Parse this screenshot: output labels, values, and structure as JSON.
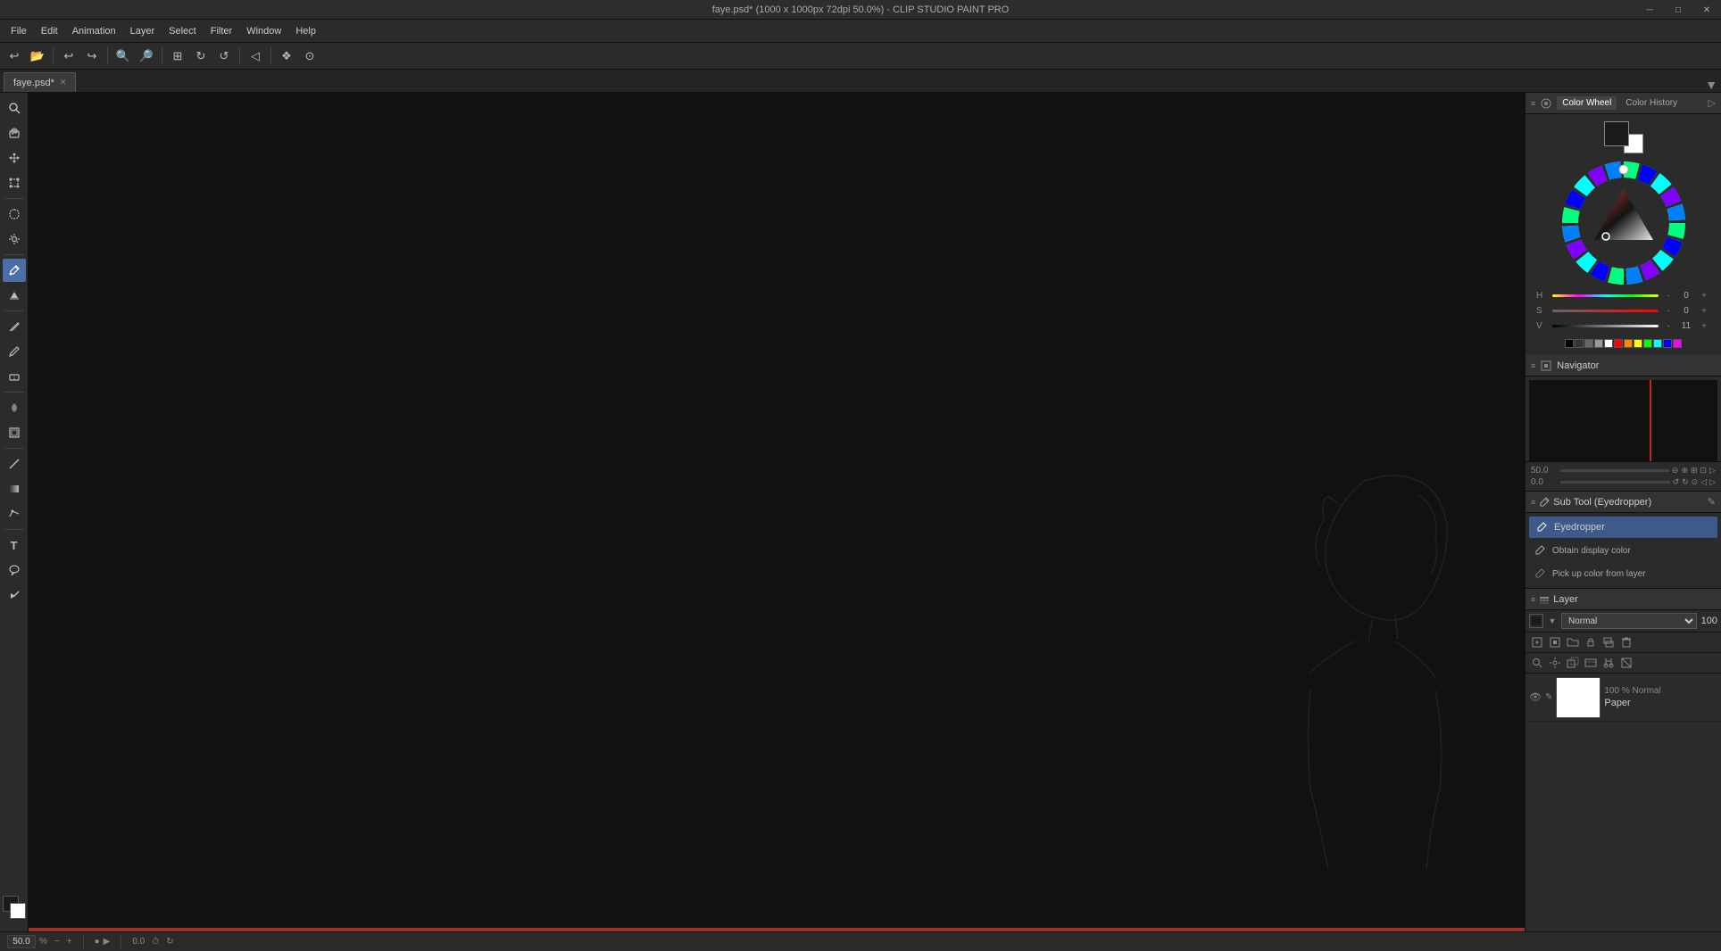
{
  "titleBar": {
    "title": "faye.psd* (1000 x 1000px 72dpi 50.0%) - CLIP STUDIO PAINT PRO",
    "minimizeLabel": "─",
    "maximizeLabel": "□",
    "closeLabel": "✕"
  },
  "menuBar": {
    "items": [
      {
        "label": "File",
        "id": "file"
      },
      {
        "label": "Edit",
        "id": "edit"
      },
      {
        "label": "Animation",
        "id": "animation"
      },
      {
        "label": "Layer",
        "id": "layer"
      },
      {
        "label": "Select",
        "id": "select"
      },
      {
        "label": "Filter",
        "id": "filter"
      },
      {
        "label": "Window",
        "id": "window"
      },
      {
        "label": "Help",
        "id": "help"
      }
    ]
  },
  "toolbar": {
    "buttons": [
      {
        "icon": "↩",
        "name": "new-file",
        "title": "New"
      },
      {
        "icon": "↩",
        "name": "open-file",
        "title": "Open"
      },
      {
        "icon": "↪",
        "name": "undo",
        "title": "Undo"
      },
      {
        "icon": "↩",
        "name": "redo",
        "title": "Redo"
      },
      {
        "icon": "⊖",
        "name": "zoom-out",
        "title": "Zoom Out"
      },
      {
        "icon": "⊕",
        "name": "zoom-in",
        "title": "Zoom In"
      },
      {
        "icon": "◻",
        "name": "fit-view",
        "title": "Fit View"
      },
      {
        "icon": "❖",
        "name": "rotate",
        "title": "Rotate"
      },
      {
        "icon": "↺",
        "name": "reset-rotate",
        "title": "Reset Rotate"
      },
      {
        "icon": "◁",
        "name": "flip-h",
        "title": "Flip Horizontal"
      },
      {
        "icon": "⊞",
        "name": "grid",
        "title": "Grid"
      },
      {
        "icon": "⊙",
        "name": "snap",
        "title": "Snap"
      }
    ]
  },
  "tabBar": {
    "tabs": [
      {
        "label": "faye.psd*",
        "id": "faye",
        "active": true
      }
    ],
    "collapseIcon": "▼"
  },
  "leftTools": {
    "tools": [
      {
        "icon": "🔍",
        "name": "zoom-tool",
        "active": false
      },
      {
        "icon": "✋",
        "name": "hand-tool",
        "active": false
      },
      {
        "icon": "↔",
        "name": "move-tool",
        "active": false
      },
      {
        "icon": "✚",
        "name": "transform-tool",
        "active": false
      },
      {
        "icon": "○",
        "name": "lasso-tool",
        "active": false
      },
      {
        "icon": "✱",
        "name": "magic-wand",
        "active": false
      },
      {
        "icon": "✏",
        "name": "pen-tool",
        "active": true
      },
      {
        "icon": "▓",
        "name": "fill-tool",
        "active": false
      },
      {
        "icon": "✒",
        "name": "ink-pen",
        "active": false
      },
      {
        "icon": "✎",
        "name": "pencil-tool",
        "active": false
      },
      {
        "icon": "▬",
        "name": "ruler-tool",
        "active": false
      },
      {
        "icon": "◎",
        "name": "blend-tool",
        "active": false
      },
      {
        "icon": "◫",
        "name": "frame-tool",
        "active": false
      },
      {
        "icon": "—",
        "name": "line-tool",
        "active": false
      },
      {
        "icon": "≡",
        "name": "gradient-tool",
        "active": false
      },
      {
        "icon": "⌇",
        "name": "curve-tool",
        "active": false
      },
      {
        "icon": "T",
        "name": "text-tool",
        "active": false
      },
      {
        "icon": "💬",
        "name": "balloon-tool",
        "active": false
      },
      {
        "icon": "➤",
        "name": "arrow-tool",
        "active": false
      }
    ],
    "colorFg": "#1a1a1a",
    "colorBg": "#ffffff"
  },
  "rightPanels": {
    "colorWheel": {
      "panelTitle": "Color Wheel",
      "tab1": "Color Wheel",
      "tab2": "Color History",
      "hValue": 0,
      "sValue": 0,
      "vValue": 11,
      "expandIcon": "▷"
    },
    "navigator": {
      "title": "Navigator"
    },
    "zoomControls": {
      "zoomValue": "50.0",
      "rotationValue": "0.0"
    },
    "subTool": {
      "title": "Sub Tool (Eyedropper)",
      "editIcon": "✎",
      "items": [
        {
          "label": "Eyedropper",
          "active": true
        },
        {
          "label": "Obtain display color",
          "active": false
        },
        {
          "label": "Pick up color from layer",
          "active": false
        }
      ]
    },
    "layer": {
      "title": "Layer",
      "blendMode": "Normal",
      "opacity": 100,
      "layers": [
        {
          "name": "Paper",
          "mode": "100 % Normal",
          "visible": true,
          "thumb": "#ffffff"
        }
      ]
    }
  },
  "statusBar": {
    "zoom": "50.0",
    "minusLabel": "−",
    "plusLabel": "+",
    "coord": "0.0",
    "zoomUnit": "%"
  }
}
